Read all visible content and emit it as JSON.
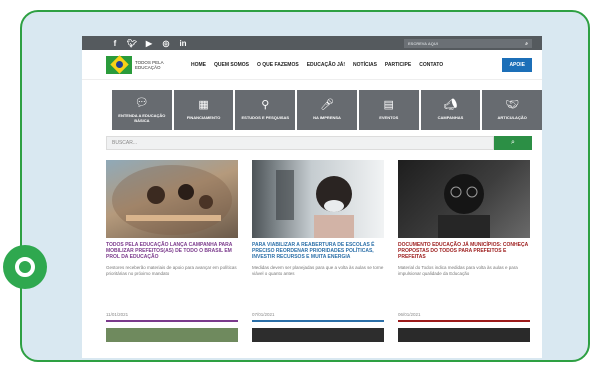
{
  "top_bar": {
    "social": [
      "f",
      "t",
      "yt",
      "ig",
      "in"
    ],
    "search_placeholder": "ESCREVA AQUI",
    "search_icon": "search-icon"
  },
  "nav": {
    "logo_text": "TODOS PELA EDUCAÇÃO",
    "links": [
      "HOME",
      "QUEM SOMOS",
      "O QUE FAZEMOS",
      "EDUCAÇÃO JÁ!",
      "NOTÍCIAS",
      "PARTICIPE",
      "CONTATO"
    ],
    "apoie": "APOIE"
  },
  "tiles": [
    {
      "icon": "chat-icon",
      "label": "ENTENDA A EDUCAÇÃO BÁSICA"
    },
    {
      "icon": "grid-icon",
      "label": "FINANCIAMENTO"
    },
    {
      "icon": "magnifier-icon",
      "label": "ESTUDOS E PESQUISAS"
    },
    {
      "icon": "microphone-icon",
      "label": "NA IMPRENSA"
    },
    {
      "icon": "calendar-icon",
      "label": "EVENTOS"
    },
    {
      "icon": "megaphone-icon",
      "label": "CAMPANHAS"
    },
    {
      "icon": "handshake-icon",
      "label": "ARTICULAÇÃO"
    }
  ],
  "busca": {
    "placeholder": "BUSCAR..."
  },
  "cards": [
    {
      "title": "TODOS PELA EDUCAÇÃO LANÇA CAMPANHA PARA MOBILIZAR PREFEITOS(AS) DE TODO O BRASIL EM PROL DA EDUCAÇÃO",
      "desc": "Gestores receberão materiais de apoio para avançar em políticas prioritárias no próximo mandato",
      "color": "#7b3a8c",
      "date": "11/01/2021"
    },
    {
      "title": "PARA VIABILIZAR A REABERTURA DE ESCOLAS É PRECISO REORDENAR PRIORIDADES POLÍTICAS, INVESTIR RECURSOS E MUITA ENERGIA",
      "desc": "Medidas devem ser planejadas para que a volta às aulas se torne viável o quanto antes",
      "color": "#2b6fa8",
      "date": "07/01/2021"
    },
    {
      "title": "DOCUMENTO EDUCAÇÃO JÁ MUNICÍPIOS: CONHEÇA PROPOSTAS DO TODOS PARA PREFEITOS E PREFEITAS",
      "desc": "Material do Todos indica medidas para volta às aulas e para impulsionar qualidade da Educação",
      "color": "#9c1b1b",
      "date": "06/01/2021"
    }
  ]
}
